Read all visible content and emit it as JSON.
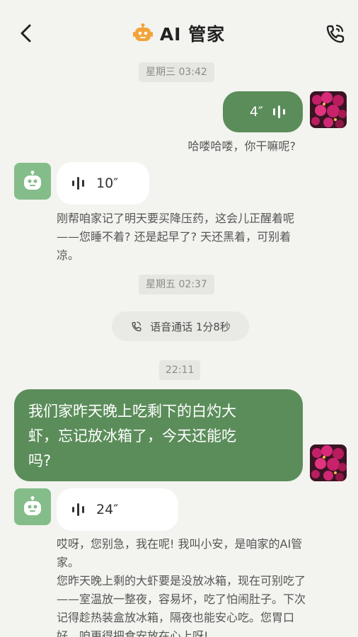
{
  "header": {
    "title": "AI 管家",
    "back_icon": "chevron-left-icon",
    "bot_icon": "robot-icon",
    "call_icon": "phone-call-icon"
  },
  "messages": {
    "ts1": "星期三 03:42",
    "user_voice_1": {
      "duration": "4″",
      "transcript": "哈喽哈喽，你干嘛呢?"
    },
    "bot_voice_1": {
      "duration": "10″",
      "transcript_lines": [
        "刚帮咱家记了明天要买降压药，这会儿正醒着呢",
        "——您睡不着? 还是起早了? 天还黑着，可别着",
        "凉。"
      ]
    },
    "ts2": "星期五 02:37",
    "call_record": "语音通话 1分8秒",
    "ts3": "22:11",
    "user_text_lines": [
      "我们家昨天晚上吃剩下的白灼大",
      "虾，忘记放冰箱了，今天还能吃",
      "吗?"
    ],
    "bot_voice_2": {
      "duration": "24″",
      "transcript_lines": [
        "哎呀，您别急，我在呢! 我叫小安，是咱家的AI管",
        "家。",
        "您昨天晚上剩的大虾要是没放冰箱，现在可别吃了",
        "——室温放一整夜，容易坏，吃了怕闹肚子。下次",
        "记得趁热装盒放冰箱，隔夜也能安心吃。您胃口",
        "好，咱更得把食安放在心上呀!"
      ]
    }
  },
  "colors": {
    "background": "#f3f3ef",
    "user_bubble": "#5b8d5a",
    "bot_avatar": "#84bd8a",
    "accent_orange": "#f2a33a"
  }
}
